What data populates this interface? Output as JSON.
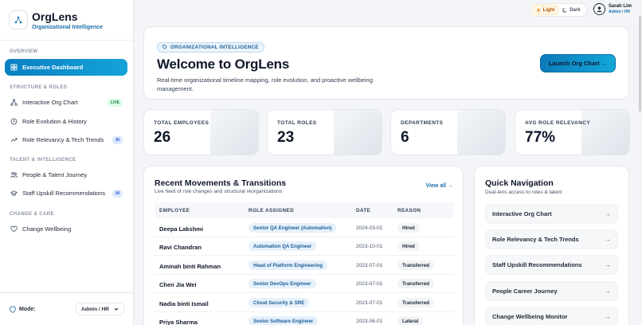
{
  "brand": {
    "name": "OrgLens",
    "subtitle": "Organizational Intelligence"
  },
  "sidebar": {
    "sections": [
      {
        "label": "OVERVIEW"
      },
      {
        "label": "STRUCTURE & ROLES"
      },
      {
        "label": "TALENT & INTELLIGENCE"
      },
      {
        "label": "CHANGE & CARE"
      }
    ],
    "items": [
      {
        "label": "Executive Dashboard",
        "icon": "dashboard-icon",
        "active": true
      },
      {
        "label": "Interactive Org Chart",
        "icon": "org-chart-icon",
        "badge": "LIVE"
      },
      {
        "label": "Role Evolution & History",
        "icon": "history-icon"
      },
      {
        "label": "Role Relevancy & Tech Trends",
        "icon": "trend-icon",
        "badge": "AI"
      },
      {
        "label": "People & Talent Journey",
        "icon": "people-icon"
      },
      {
        "label": "Staff Upskill Recommendations",
        "icon": "graduation-icon",
        "badge": "AI"
      },
      {
        "label": "Change Wellbeing",
        "icon": "heart-icon"
      }
    ],
    "mode": {
      "label": "Mode:",
      "value": "Admin / HR"
    }
  },
  "topbar": {
    "theme": {
      "light": "Light",
      "dark": "Dark",
      "selected": "Light"
    },
    "user": {
      "name": "Sarah Lim",
      "role": "Admin / HR"
    }
  },
  "hero": {
    "tag": "ORGANIZATIONAL INTELLIGENCE",
    "title": "Welcome to OrgLens",
    "description": "Real-time organizational timeline mapping, role evolution, and proactive wellbeing management.",
    "button": "Launch Org Chart →"
  },
  "stats": [
    {
      "label": "TOTAL EMPLOYEES",
      "value": "26"
    },
    {
      "label": "TOTAL ROLES",
      "value": "23"
    },
    {
      "label": "DEPARTMENTS",
      "value": "6"
    },
    {
      "label": "AVG ROLE RELEVANCY",
      "value": "77%"
    }
  ],
  "movements": {
    "title": "Recent Movements & Transitions",
    "subtitle": "Live feed of role changes and structural reorganizations",
    "view_all": "View all →",
    "columns": [
      "EMPLOYEE",
      "ROLE ASSIGNED",
      "DATE",
      "REASON"
    ],
    "rows": [
      {
        "name": "Deepa Lakshmi",
        "role": "Senior QA Engineer (Automation)",
        "date": "2024-03-01",
        "reason": "Hired"
      },
      {
        "name": "Ravi Chandran",
        "role": "Automation QA Engineer",
        "date": "2023-10-01",
        "reason": "Hired"
      },
      {
        "name": "Aminah binti Rahman",
        "role": "Head of Platform Engineering",
        "date": "2023-07-01",
        "reason": "Transferred"
      },
      {
        "name": "Chen Jia Wei",
        "role": "Senior DevOps Engineer",
        "date": "2023-07-01",
        "reason": "Transferred"
      },
      {
        "name": "Nadia binti Ismail",
        "role": "Cloud Security & SRE",
        "date": "2023-07-01",
        "reason": "Transferred"
      },
      {
        "name": "Priya Sharma",
        "role": "Senior Software Engineer",
        "date": "2023-06-01",
        "reason": "Lateral"
      }
    ]
  },
  "quick_nav": {
    "title": "Quick Navigation",
    "subtitle": "Dual-lens access to roles & talent",
    "items": [
      {
        "label": "Interactive Org Chart"
      },
      {
        "label": "Role Relevancy & Tech Trends"
      },
      {
        "label": "Staff Upskill Recommendations"
      },
      {
        "label": "People Career Journey"
      },
      {
        "label": "Change Wellbeing Monitor"
      }
    ]
  }
}
